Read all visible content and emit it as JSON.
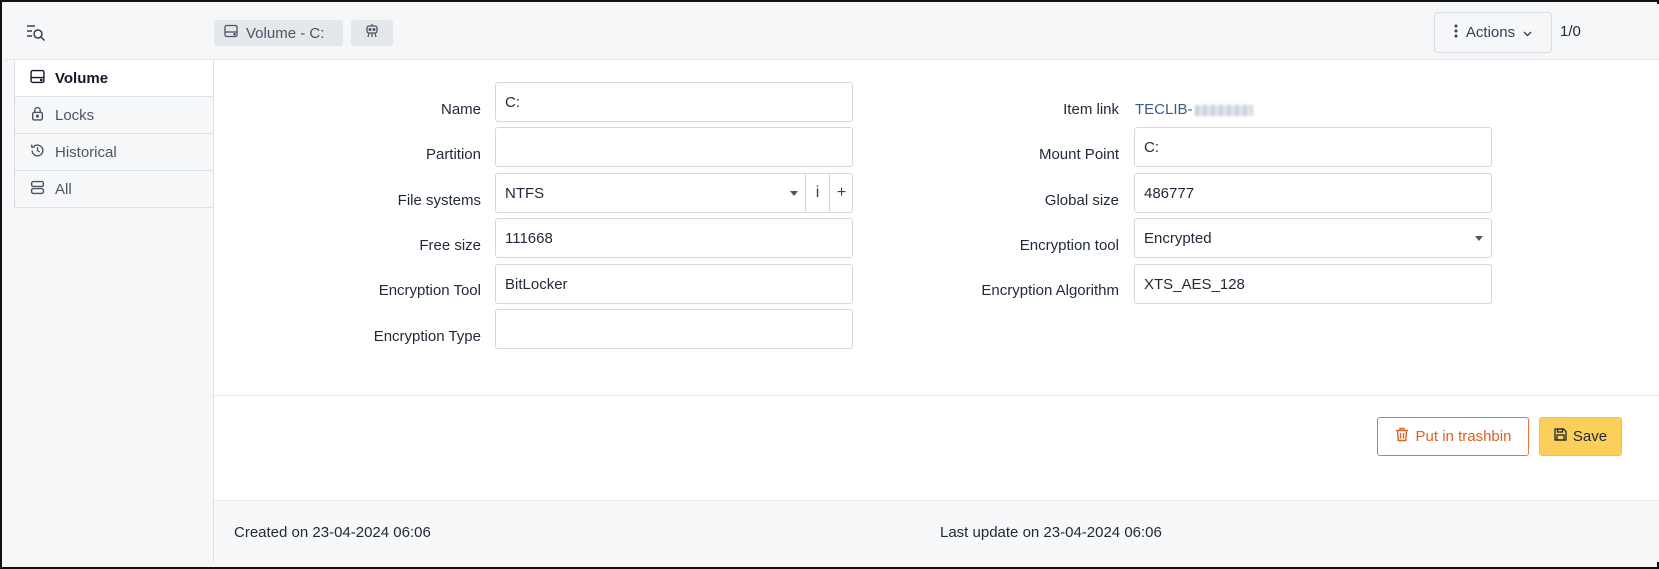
{
  "header": {
    "breadcrumb_volume": "Volume -  C:",
    "actions_label": "Actions",
    "pager": "1/0"
  },
  "sidebar": {
    "items": [
      {
        "label": "Volume",
        "icon": "volume-icon",
        "active": true
      },
      {
        "label": "Locks",
        "icon": "lock-icon",
        "active": false
      },
      {
        "label": "Historical",
        "icon": "history-icon",
        "active": false
      },
      {
        "label": "All",
        "icon": "all-icon",
        "active": false
      }
    ]
  },
  "form": {
    "left": {
      "name_label": "Name",
      "name_value": "C:",
      "partition_label": "Partition",
      "partition_value": "",
      "filesystems_label": "File systems",
      "filesystems_value": "NTFS",
      "freesize_label": "Free size",
      "freesize_value": "111668",
      "enc_tool_label": "Encryption Tool",
      "enc_tool_value": "BitLocker",
      "enc_type_label": "Encryption Type",
      "enc_type_value": ""
    },
    "right": {
      "itemlink_label": "Item link",
      "itemlink_value": "TECLIB-",
      "mountpoint_label": "Mount Point",
      "mountpoint_value": "C:",
      "globalsize_label": "Global size",
      "globalsize_value": "486777",
      "enc_tool_label": "Encryption tool",
      "enc_tool_value": "Encrypted",
      "enc_algo_label": "Encryption Algorithm",
      "enc_algo_value": "XTS_AES_128"
    },
    "info_addon": "i",
    "add_addon": "+"
  },
  "buttons": {
    "trash_label": "Put in trashbin",
    "save_label": "Save"
  },
  "footer": {
    "created": "Created on 23-04-2024 06:06",
    "updated": "Last update on 23-04-2024 06:06"
  },
  "colors": {
    "accent_save": "#fccf5b",
    "trash": "#e0621f",
    "link": "#3b5b8c"
  }
}
